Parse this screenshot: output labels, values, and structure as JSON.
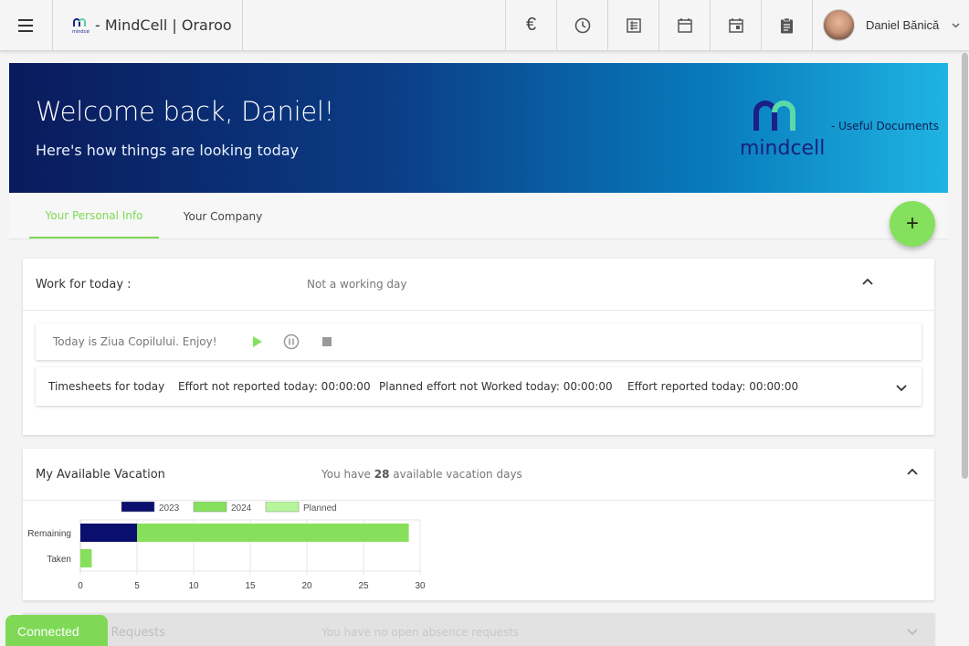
{
  "header": {
    "brand_logo_text": "mindcell",
    "title": "- MindCell | Oraroo",
    "icons": [
      "euro-icon",
      "clock-icon",
      "table-icon",
      "calendar-icon",
      "calendar-event-icon",
      "clipboard-icon"
    ],
    "euro_symbol": "€",
    "user_name": "Daniel Bănică"
  },
  "banner": {
    "title": "Welcome back, Daniel!",
    "subtitle": "Here's how things are looking today",
    "logo_text": "mindcell",
    "docs_link": "- Useful Documents"
  },
  "tabs": {
    "personal": "Your Personal Info",
    "company": "Your Company"
  },
  "fab_label": "+",
  "work": {
    "title": "Work for today :",
    "status": "Not a working day",
    "holiday_text": "Today is Ziua Copilului. Enjoy!",
    "timesheets": {
      "label": "Timesheets for today",
      "not_reported": "Effort not reported today:  00:00:00",
      "planned_not_worked": "Planned effort not Worked today:  00:00:00",
      "reported": "Effort reported today:  00:00:00"
    }
  },
  "vacation": {
    "title": "My Available Vacation",
    "status_prefix": "You have ",
    "days": "28",
    "status_suffix": " available vacation days"
  },
  "chart_data": {
    "type": "bar",
    "orientation": "horizontal",
    "stacked": true,
    "categories": [
      "Remaining",
      "Taken"
    ],
    "series": [
      {
        "name": "2023",
        "color": "#0a0f6e",
        "values": [
          5,
          0
        ]
      },
      {
        "name": "2024",
        "color": "#86e05c",
        "values": [
          24,
          1
        ]
      },
      {
        "name": "Planned",
        "color": "#b7f59a",
        "values": [
          0,
          0
        ]
      }
    ],
    "xlim": [
      0,
      30
    ],
    "xticks": [
      "0",
      "5",
      "10",
      "15",
      "20",
      "25",
      "30"
    ],
    "grid": true,
    "legend": "top"
  },
  "absence": {
    "title": "My Absence Requests",
    "status": "You have no open absence requests"
  },
  "toast": "Connected"
}
